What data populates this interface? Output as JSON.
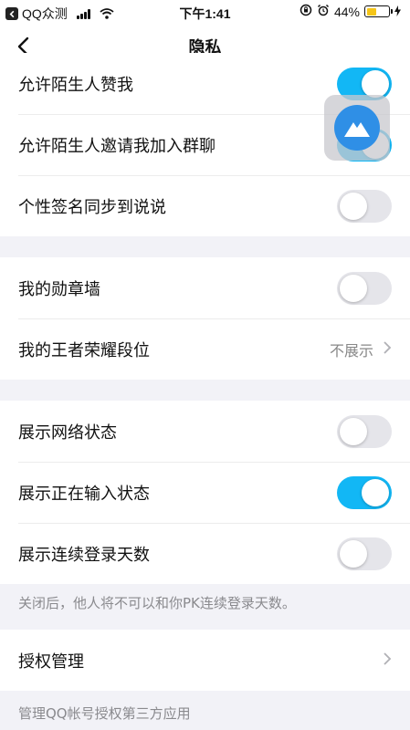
{
  "status_bar": {
    "carrier": "QQ众测",
    "time": "下午1:41",
    "battery_percent_label": "44%",
    "battery_level": 0.44
  },
  "nav": {
    "title": "隐私"
  },
  "groups": [
    {
      "rows": [
        {
          "label": "允许陌生人赞我",
          "toggle": true
        },
        {
          "label": "允许陌生人邀请我加入群聊",
          "toggle": true
        },
        {
          "label": "个性签名同步到说说",
          "toggle": false
        }
      ]
    },
    {
      "rows": [
        {
          "label": "我的勋章墙",
          "toggle": false
        },
        {
          "label": "我的王者荣耀段位",
          "value": "不展示"
        }
      ]
    },
    {
      "rows": [
        {
          "label": "展示网络状态",
          "toggle": false
        },
        {
          "label": "展示正在输入状态",
          "toggle": true
        },
        {
          "label": "展示连续登录天数",
          "toggle": false
        }
      ],
      "note": "关闭后，他人将不可以和你PK连续登录天数。"
    },
    {
      "rows": [
        {
          "label": "授权管理"
        }
      ],
      "note": "管理QQ帐号授权第三方应用"
    }
  ],
  "colors": {
    "accent": "#12b7f5",
    "toggle_off": "#e5e5ea",
    "background": "#f2f2f7",
    "battery": "#f5c518"
  },
  "icons": [
    "back-app-icon",
    "signal-icon",
    "wifi-icon",
    "orientation-lock-icon",
    "alarm-icon",
    "battery-icon",
    "charging-icon",
    "back-arrow-icon",
    "chevron-right-icon",
    "floating-assistant-icon"
  ]
}
